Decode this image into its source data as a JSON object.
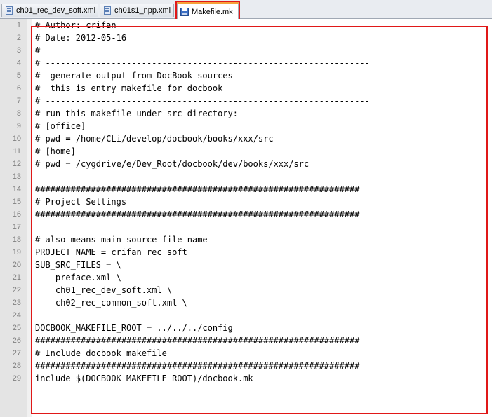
{
  "tabs": [
    {
      "label": "ch01_rec_dev_soft.xml",
      "icon": "file-xml-icon",
      "active": false
    },
    {
      "label": "ch01s1_npp.xml",
      "icon": "file-xml-icon",
      "active": false
    },
    {
      "label": "Makefile.mk",
      "icon": "file-saved-icon",
      "active": true
    }
  ],
  "editor": {
    "lines": [
      {
        "num": "1",
        "text": "# Author: crifan"
      },
      {
        "num": "2",
        "text": "# Date: 2012-05-16"
      },
      {
        "num": "3",
        "text": "#"
      },
      {
        "num": "4",
        "text": "# ----------------------------------------------------------------"
      },
      {
        "num": "5",
        "text": "#  generate output from DocBook sources"
      },
      {
        "num": "6",
        "text": "#  this is entry makefile for docbook"
      },
      {
        "num": "7",
        "text": "# ----------------------------------------------------------------"
      },
      {
        "num": "8",
        "text": "# run this makefile under src directory:"
      },
      {
        "num": "9",
        "text": "# [office]"
      },
      {
        "num": "10",
        "text": "# pwd = /home/CLi/develop/docbook/books/xxx/src"
      },
      {
        "num": "11",
        "text": "# [home]"
      },
      {
        "num": "12",
        "text": "# pwd = /cygdrive/e/Dev_Root/docbook/dev/books/xxx/src"
      },
      {
        "num": "13",
        "text": ""
      },
      {
        "num": "14",
        "text": "################################################################"
      },
      {
        "num": "15",
        "text": "# Project Settings"
      },
      {
        "num": "16",
        "text": "################################################################"
      },
      {
        "num": "17",
        "text": ""
      },
      {
        "num": "18",
        "text": "# also means main source file name"
      },
      {
        "num": "19",
        "text": "PROJECT_NAME = crifan_rec_soft"
      },
      {
        "num": "20",
        "text": "SUB_SRC_FILES = \\"
      },
      {
        "num": "21",
        "text": "    preface.xml \\"
      },
      {
        "num": "22",
        "text": "    ch01_rec_dev_soft.xml \\"
      },
      {
        "num": "23",
        "text": "    ch02_rec_common_soft.xml \\"
      },
      {
        "num": "24",
        "text": ""
      },
      {
        "num": "25",
        "text": "DOCBOOK_MAKEFILE_ROOT = ../../../config"
      },
      {
        "num": "26",
        "text": "################################################################"
      },
      {
        "num": "27",
        "text": "# Include docbook makefile"
      },
      {
        "num": "28",
        "text": "################################################################"
      },
      {
        "num": "29",
        "text": "include $(DOCBOOK_MAKEFILE_ROOT)/docbook.mk"
      }
    ]
  },
  "colors": {
    "highlight": "#e01818",
    "active_tab_accent": "#f6a23a",
    "gutter": "#e4e4e4"
  }
}
